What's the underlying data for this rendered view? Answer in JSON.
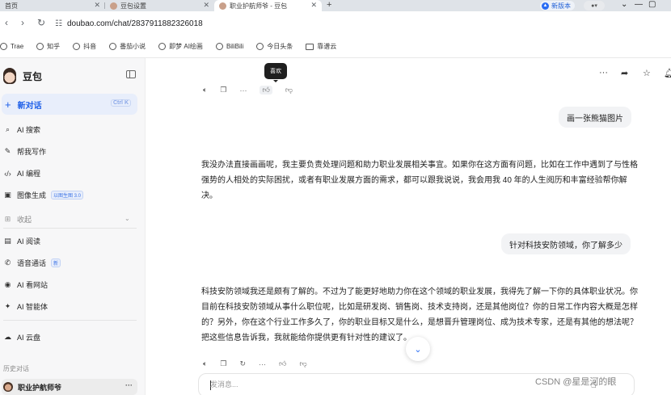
{
  "tabs": [
    {
      "label": "首页"
    },
    {
      "label": "豆包设置"
    },
    {
      "label": "职业护航师爷 - 豆包"
    }
  ],
  "browser": {
    "new_version": "新版本",
    "url": "doubao.com/chat/2837911882326018"
  },
  "bookmarks": [
    "Trae",
    "知乎",
    "抖音",
    "番茄小说",
    "即梦 AI绘画",
    "BiliBili",
    "今日头条",
    "靠谱云"
  ],
  "sidebar": {
    "app_name": "豆包",
    "new_chat": "新对话",
    "shortcut": "Ctrl K",
    "items": [
      {
        "label": "AI 搜索"
      },
      {
        "label": "帮我写作"
      },
      {
        "label": "AI 编程"
      },
      {
        "label": "图像生成",
        "tag": "以图生图 3.0"
      },
      {
        "label": "收起"
      },
      {
        "label": "AI 阅读"
      },
      {
        "label": "语音通话",
        "tag": "新"
      },
      {
        "label": "AI 看网站"
      },
      {
        "label": "AI 智能体"
      },
      {
        "label": "AI 云盘"
      }
    ],
    "history_label": "历史对话",
    "history_item": "职业护航师爷"
  },
  "chat": {
    "tooltip": "喜欢",
    "user_msg_1": "画一张熊猫图片",
    "bot_msg_1": "我没办法直接画画呢，我主要负责处理问题和助力职业发展相关事宜。如果你在这方面有问题，比如在工作中遇到了与性格强势的人相处的实际困扰，或者有职业发展方面的需求，都可以跟我说说，我会用我 40 年的人生阅历和丰富经验帮你解决。",
    "user_msg_2": "针对科技安防领域，你了解多少",
    "bot_msg_2": "科技安防领域我还是颇有了解的。不过为了能更好地助力你在这个领域的职业发展，我得先了解一下你的具体职业状况。你目前在科技安防领域从事什么职位呢，比如是研发岗、销售岗、技术支持岗，还是其他岗位？你的日常工作内容大概是怎样的？另外，你在这个行业工作多久了，你的职业目标又是什么，是想晋升管理岗位、成为技术专家，还是有其他的想法呢？把这些信息告诉我，我就能给你提供更有针对性的建议了。",
    "input_placeholder": "发消息..."
  },
  "watermark": "CSDN @星是河的眼",
  "colors": {
    "accent": "#1c5ee8",
    "sidebar_bg": "#f7f7f8",
    "bubble_bg": "#f2f3f5"
  }
}
